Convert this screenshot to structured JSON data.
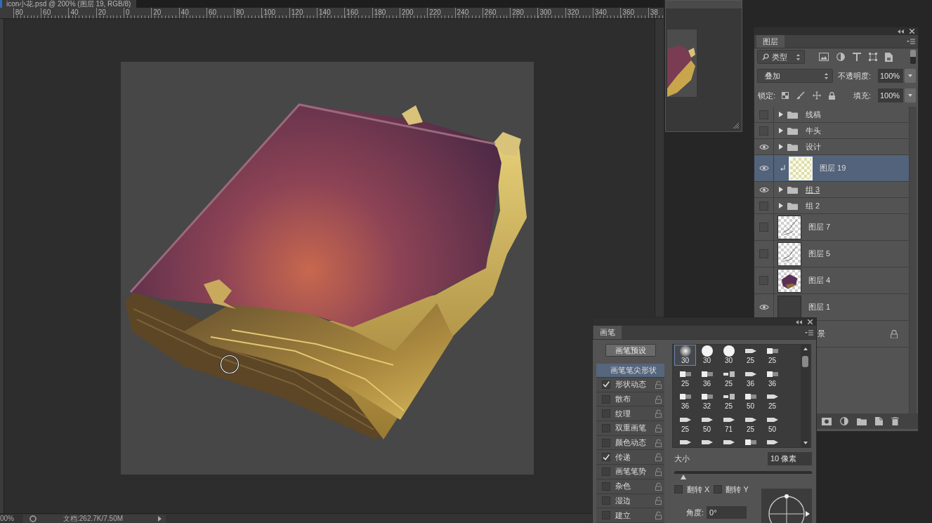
{
  "document": {
    "title": "icon小花.psd @ 200% (图层 19, RGB/8)",
    "ruler_labels": [
      "80",
      "60",
      "40",
      "20",
      "0",
      "20",
      "40",
      "60",
      "80",
      "100",
      "120",
      "140",
      "160",
      "180",
      "200",
      "220",
      "240",
      "260",
      "280",
      "300",
      "320",
      "340",
      "360",
      "38"
    ],
    "status_bar": {
      "zoom": "00%",
      "info": "文档:262.7K/7.50M"
    }
  },
  "layers_panel": {
    "tab": "图层",
    "filter": "类型",
    "blend_mode": "叠加",
    "opacity_label": "不透明度:",
    "opacity": "100%",
    "lock_label": "锁定:",
    "fill_label": "填充:",
    "fill": "100%",
    "layers": [
      {
        "name": "线稿",
        "kind": "group",
        "visible": false,
        "selected": false,
        "clipped": false,
        "clip_base": false,
        "locked": false
      },
      {
        "name": "牛头",
        "kind": "group",
        "visible": false,
        "selected": false,
        "clipped": false,
        "clip_base": false,
        "locked": false
      },
      {
        "name": "设计",
        "kind": "group",
        "visible": true,
        "selected": false,
        "clipped": false,
        "clip_base": false,
        "locked": false
      },
      {
        "name": "图层 19",
        "kind": "blank",
        "visible": true,
        "selected": true,
        "clipped": true,
        "clip_base": false,
        "locked": false
      },
      {
        "name": "组 3",
        "kind": "group",
        "visible": true,
        "selected": false,
        "clipped": false,
        "clip_base": true,
        "locked": false
      },
      {
        "name": "组 2",
        "kind": "group",
        "visible": false,
        "selected": false,
        "clipped": false,
        "clip_base": false,
        "locked": false
      },
      {
        "name": "图层 7",
        "kind": "sketch",
        "visible": false,
        "selected": false,
        "clipped": false,
        "clip_base": false,
        "locked": false
      },
      {
        "name": "图层 5",
        "kind": "sketch",
        "visible": false,
        "selected": false,
        "clipped": false,
        "clip_base": false,
        "locked": false
      },
      {
        "name": "图层 4",
        "kind": "painting",
        "visible": false,
        "selected": false,
        "clipped": false,
        "clip_base": false,
        "locked": false
      },
      {
        "name": "图层 1",
        "kind": "fill",
        "visible": true,
        "selected": false,
        "clipped": false,
        "clip_base": false,
        "locked": false
      },
      {
        "name": "景",
        "kind": "background",
        "selected": false,
        "clip_base": false,
        "locked": true
      }
    ]
  },
  "brush_panel": {
    "tab": "画笔",
    "preset_button": "画笔预设",
    "options": [
      {
        "label": "画笔笔尖形状",
        "kind": "heading",
        "selected": true
      },
      {
        "label": "形状动态",
        "kind": "option",
        "checked": true,
        "selected": false
      },
      {
        "label": "散布",
        "kind": "option",
        "checked": false,
        "selected": false
      },
      {
        "label": "纹理",
        "kind": "option",
        "checked": false,
        "selected": false
      },
      {
        "label": "双重画笔",
        "kind": "option",
        "checked": false,
        "selected": false
      },
      {
        "label": "颜色动态",
        "kind": "option",
        "checked": false,
        "selected": false
      },
      {
        "label": "传递",
        "kind": "option",
        "checked": true,
        "selected": false
      },
      {
        "label": "画笔笔势",
        "kind": "option",
        "checked": false,
        "selected": false
      },
      {
        "label": "杂色",
        "kind": "option",
        "checked": false,
        "selected": false
      },
      {
        "label": "湿边",
        "kind": "option",
        "checked": false,
        "selected": false
      },
      {
        "label": "建立",
        "kind": "option",
        "checked": false,
        "selected": false
      }
    ],
    "tips": [
      {
        "size": "30",
        "kind": "soft",
        "selected": true
      },
      {
        "size": "30",
        "kind": "hard",
        "selected": false
      },
      {
        "size": "30",
        "kind": "hard",
        "selected": false
      },
      {
        "size": "25",
        "kind": "pointed",
        "selected": false
      },
      {
        "size": "25",
        "kind": "block",
        "selected": false
      },
      {
        "size": "25",
        "kind": "block",
        "selected": false
      },
      {
        "size": "36",
        "kind": "block",
        "selected": false
      },
      {
        "size": "25",
        "kind": "split",
        "selected": false
      },
      {
        "size": "36",
        "kind": "pointed",
        "selected": false
      },
      {
        "size": "36",
        "kind": "block",
        "selected": false
      },
      {
        "size": "36",
        "kind": "block",
        "selected": false
      },
      {
        "size": "32",
        "kind": "block",
        "selected": false
      },
      {
        "size": "25",
        "kind": "split",
        "selected": false
      },
      {
        "size": "50",
        "kind": "block",
        "selected": false
      },
      {
        "size": "25",
        "kind": "pointed",
        "selected": false
      },
      {
        "size": "25",
        "kind": "pointed",
        "selected": false
      },
      {
        "size": "50",
        "kind": "pointed",
        "selected": false
      },
      {
        "size": "71",
        "kind": "pointed",
        "selected": false
      },
      {
        "size": "25",
        "kind": "pointed",
        "selected": false
      },
      {
        "size": "50",
        "kind": "pointed",
        "selected": false
      },
      {
        "kind": "pointed",
        "selected": false
      },
      {
        "kind": "pointed",
        "selected": false
      },
      {
        "kind": "pointed",
        "selected": false
      },
      {
        "kind": "block",
        "selected": false
      },
      {
        "kind": "pointed",
        "selected": false
      }
    ],
    "size_label": "大小",
    "size": "10 像素",
    "size_slider": {
      "level": 0.04
    },
    "flip_x": {
      "label": "翻转 X",
      "checked": false
    },
    "flip_y": {
      "label": "翻转 Y",
      "checked": false
    },
    "angle_label": "角度:",
    "angle": "0°"
  }
}
